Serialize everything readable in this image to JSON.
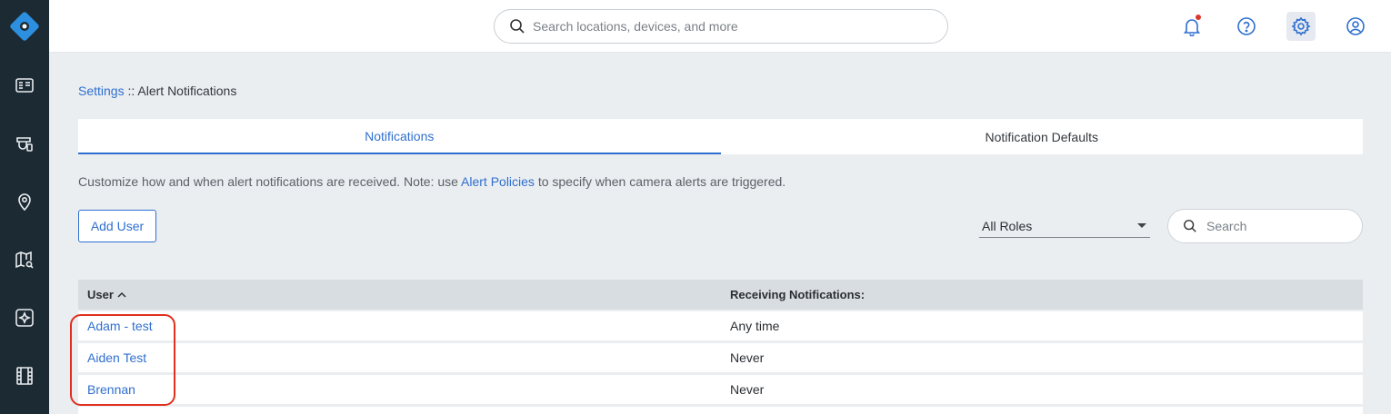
{
  "topbar": {
    "search_placeholder": "Search locations, devices, and more"
  },
  "nav": {
    "icons": [
      "logo-icon",
      "dashboard-icon",
      "devices-icon",
      "location-pin-icon",
      "map-search-icon",
      "analytics-icon",
      "video-film-icon"
    ]
  },
  "breadcrumb": {
    "root": "Settings",
    "separator": " :: ",
    "current": "Alert Notifications"
  },
  "tabs": [
    {
      "label": "Notifications",
      "active": true
    },
    {
      "label": "Notification Defaults",
      "active": false
    }
  ],
  "description": {
    "before": "Customize how and when alert notifications are received. Note: use ",
    "link": "Alert Policies",
    "after": " to specify when camera alerts are triggered."
  },
  "controls": {
    "add_user_label": "Add User",
    "roles_selected": "All Roles",
    "search_placeholder": "Search"
  },
  "table": {
    "headers": {
      "user": "User",
      "receiving": "Receiving Notifications:"
    },
    "rows": [
      {
        "user": "Adam - test",
        "receiving": "Any time"
      },
      {
        "user": "Aiden Test",
        "receiving": "Never"
      },
      {
        "user": "Brennan",
        "receiving": "Never"
      }
    ]
  },
  "colors": {
    "accent": "#2f6fcf",
    "sidebar": "#1c2a33",
    "highlight": "#e0301e",
    "notification_dot": "#d9382c"
  }
}
